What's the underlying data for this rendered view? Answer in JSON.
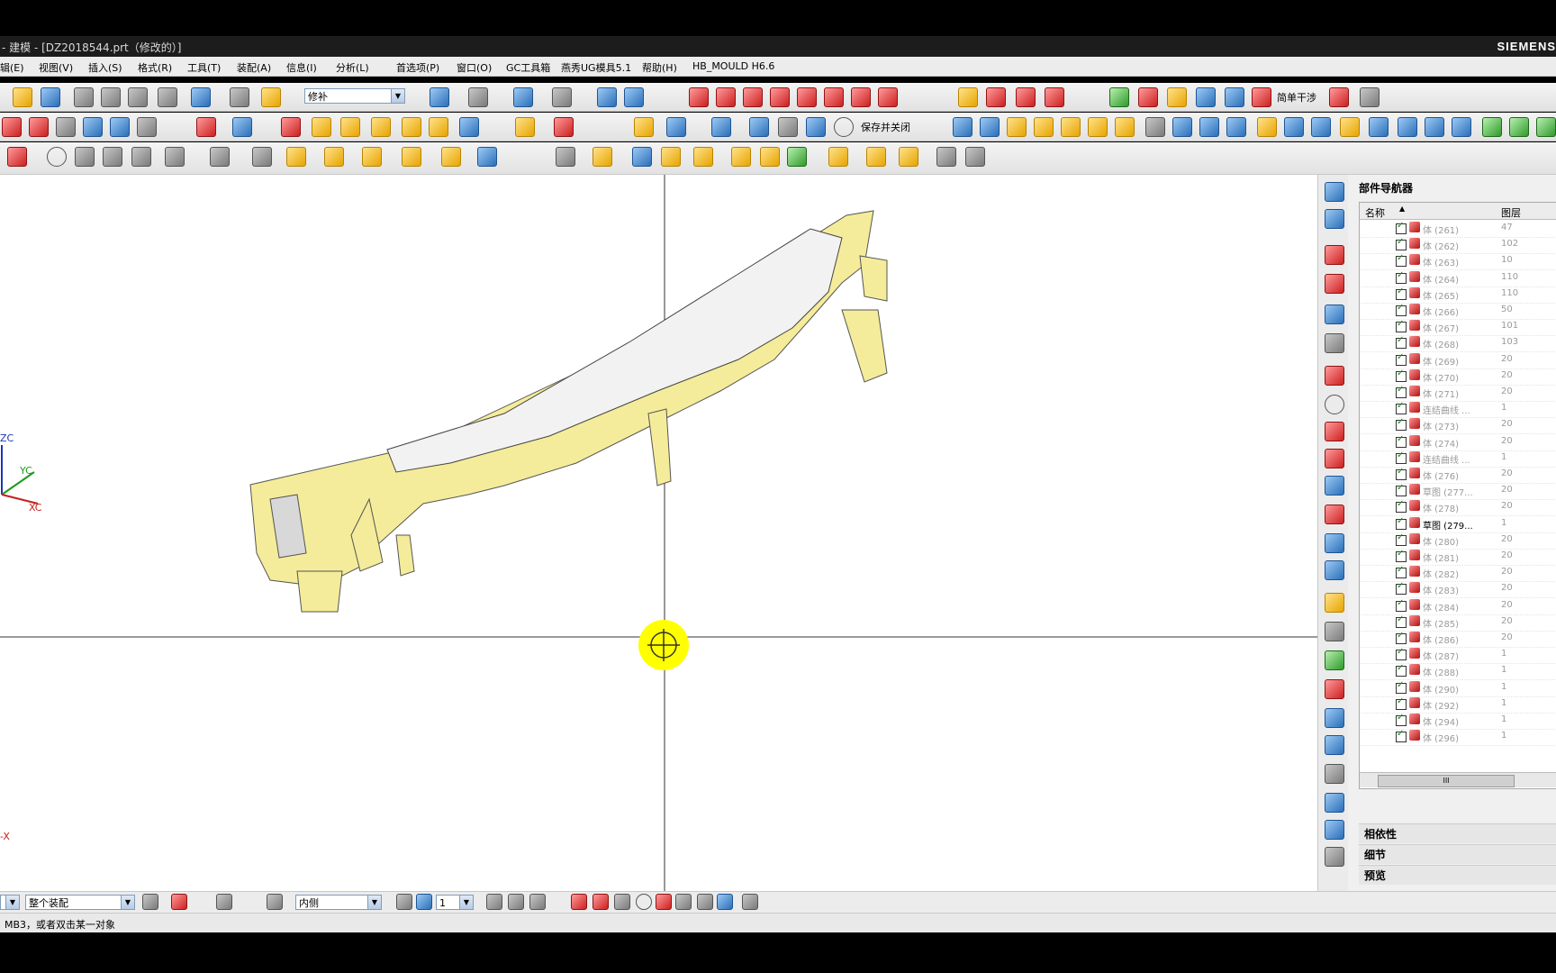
{
  "window": {
    "title": "- 建模 - [DZ2018544.prt（修改的）]",
    "brand": "SIEMENS"
  },
  "menu": [
    "辑(E)",
    "视图(V)",
    "插入(S)",
    "格式(R)",
    "工具(T)",
    "装配(A)",
    "信息(I)",
    "分析(L)",
    "首选项(P)",
    "窗口(O)",
    "GC工具箱",
    "燕秀UG模具5.1",
    "帮助(H)",
    "HB_MOULD H6.6"
  ],
  "toolbar1": {
    "command_combo": "修补",
    "simple_interference": "简单干涉"
  },
  "toolbar2": {
    "save_close": "保存并关闭"
  },
  "viewport": {
    "axis_zc": "ZC",
    "axis_yc": "YC",
    "axis_xc": "XC",
    "axis_x2": "-X"
  },
  "navigator": {
    "title": "部件导航器",
    "col_name": "名称",
    "col_layer": "图层",
    "rows": [
      {
        "name": "体 (261)",
        "layer": "47"
      },
      {
        "name": "体 (262)",
        "layer": "102"
      },
      {
        "name": "体 (263)",
        "layer": "10"
      },
      {
        "name": "体 (264)",
        "layer": "110"
      },
      {
        "name": "体 (265)",
        "layer": "110"
      },
      {
        "name": "体 (266)",
        "layer": "50"
      },
      {
        "name": "体 (267)",
        "layer": "101"
      },
      {
        "name": "体 (268)",
        "layer": "103"
      },
      {
        "name": "体 (269)",
        "layer": "20"
      },
      {
        "name": "体 (270)",
        "layer": "20"
      },
      {
        "name": "体 (271)",
        "layer": "20"
      },
      {
        "name": "连结曲线 ...",
        "layer": "1"
      },
      {
        "name": "体 (273)",
        "layer": "20"
      },
      {
        "name": "体 (274)",
        "layer": "20"
      },
      {
        "name": "连结曲线 ...",
        "layer": "1"
      },
      {
        "name": "体 (276)",
        "layer": "20"
      },
      {
        "name": "草图 (277...",
        "layer": "20"
      },
      {
        "name": "体 (278)",
        "layer": "20"
      },
      {
        "name": "草图 (279...",
        "layer": "1"
      },
      {
        "name": "体 (280)",
        "layer": "20"
      },
      {
        "name": "体 (281)",
        "layer": "20"
      },
      {
        "name": "体 (282)",
        "layer": "20"
      },
      {
        "name": "体 (283)",
        "layer": "20"
      },
      {
        "name": "体 (284)",
        "layer": "20"
      },
      {
        "name": "体 (285)",
        "layer": "20"
      },
      {
        "name": "体 (286)",
        "layer": "20"
      },
      {
        "name": "体 (287)",
        "layer": "1"
      },
      {
        "name": "体 (288)",
        "layer": "1"
      },
      {
        "name": "体 (290)",
        "layer": "1"
      },
      {
        "name": "体 (292)",
        "layer": "1"
      },
      {
        "name": "体 (294)",
        "layer": "1"
      },
      {
        "name": "体 (296)",
        "layer": "1"
      }
    ],
    "scroll_label": "III",
    "sections": [
      "相依性",
      "细节",
      "预览"
    ]
  },
  "bottombar": {
    "filter": "整个装配",
    "selection_scope": "内侧",
    "layer": "1"
  },
  "status": {
    "message": "MB3，或者双击某一对象"
  }
}
